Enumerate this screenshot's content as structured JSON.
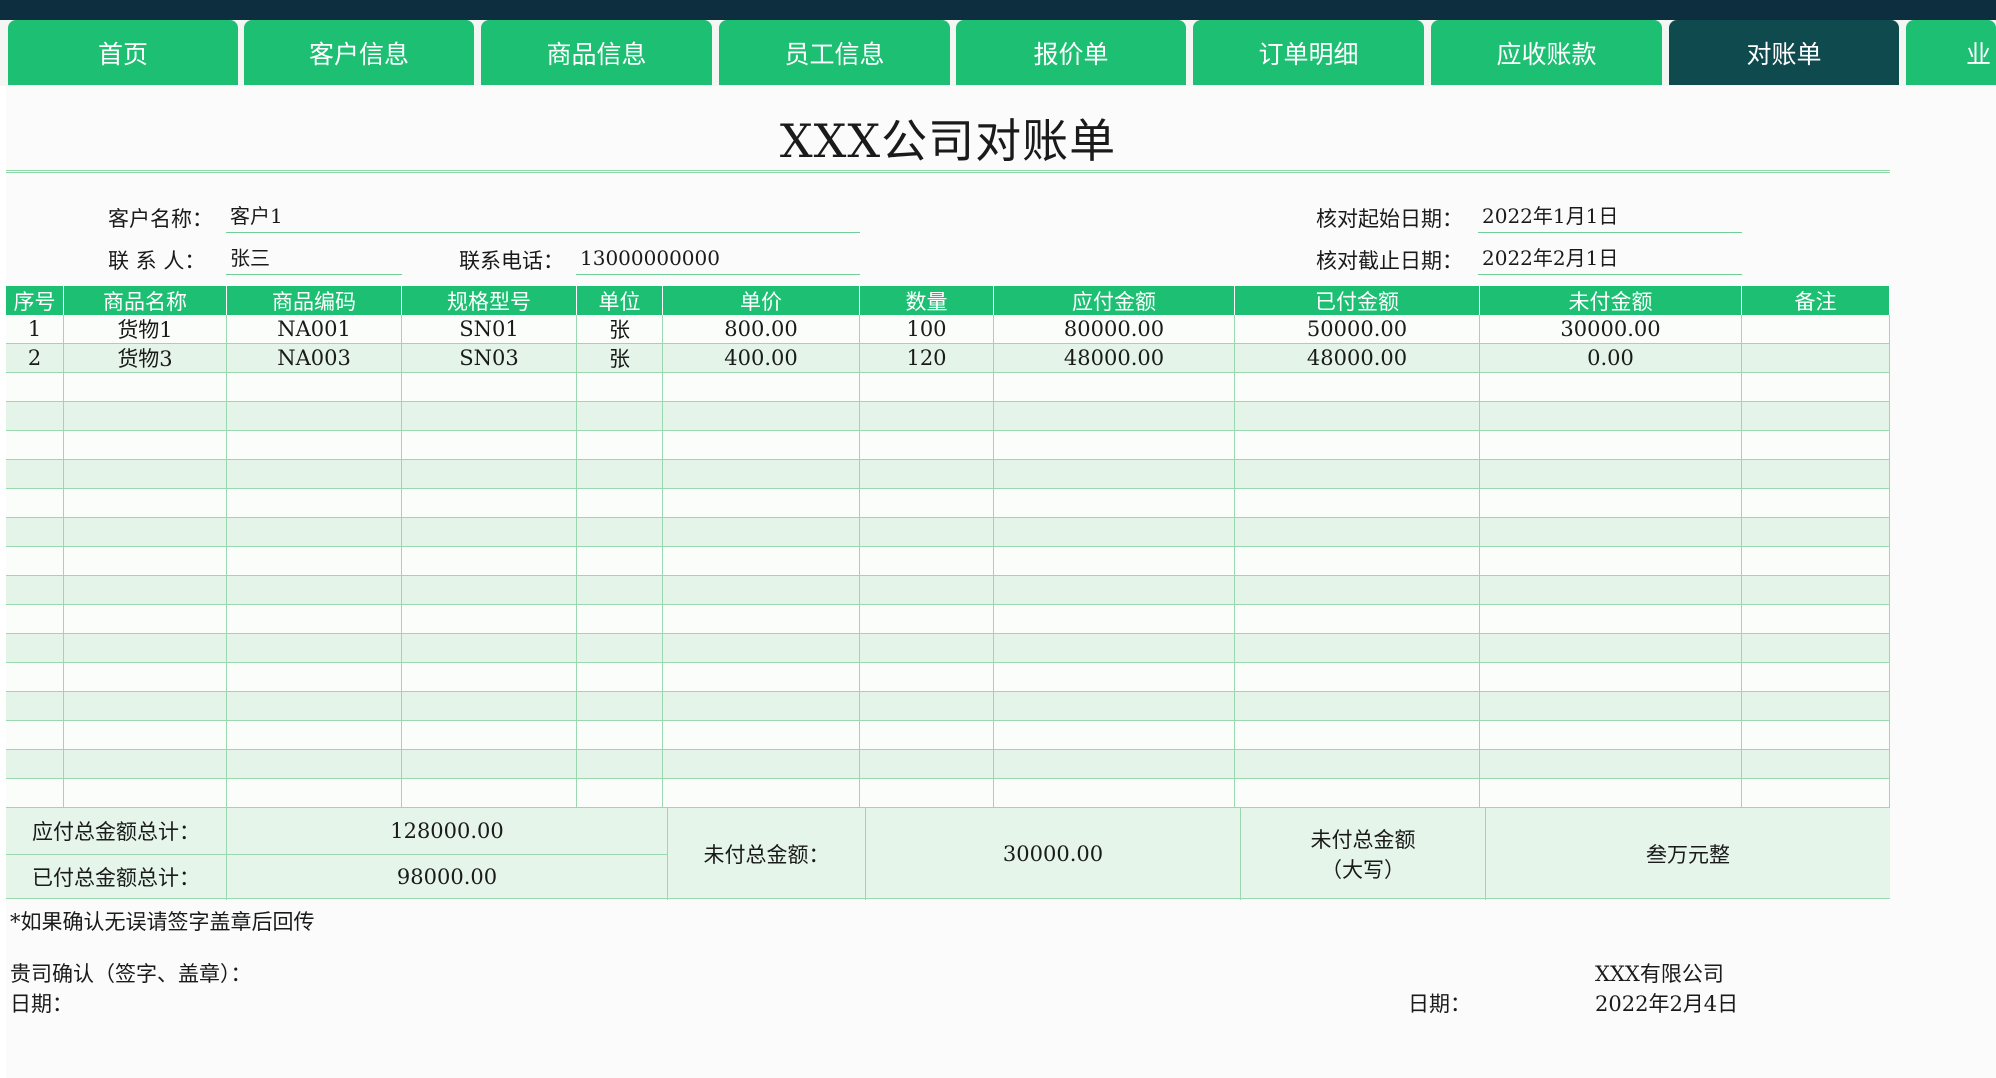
{
  "nav": {
    "tabs": [
      {
        "label": "首页"
      },
      {
        "label": "客户信息"
      },
      {
        "label": "商品信息"
      },
      {
        "label": "员工信息"
      },
      {
        "label": "报价单"
      },
      {
        "label": "订单明细"
      },
      {
        "label": "应收账款"
      },
      {
        "label": "对账单"
      },
      {
        "label": "业"
      }
    ],
    "active_index": 7
  },
  "doc": {
    "title": "XXX公司对账单",
    "customer_label": "客户名称：",
    "customer_value": "客户1",
    "contact_label": "联 系 人：",
    "contact_value": "张三",
    "phone_label": "联系电话：",
    "phone_value": "13000000000",
    "start_label": "核对起始日期：",
    "start_value": "2022年1月1日",
    "end_label": "核对截止日期：",
    "end_value": "2022年2月1日"
  },
  "table": {
    "columns": [
      "序号",
      "商品名称",
      "商品编码",
      "规格型号",
      "单位",
      "单价",
      "数量",
      "应付金额",
      "已付金额",
      "未付金额",
      "备注"
    ],
    "rows": [
      [
        "1",
        "货物1",
        "NA001",
        "SN01",
        "张",
        "800.00",
        "100",
        "80000.00",
        "50000.00",
        "30000.00",
        ""
      ],
      [
        "2",
        "货物3",
        "NA003",
        "SN03",
        "张",
        "400.00",
        "120",
        "48000.00",
        "48000.00",
        "0.00",
        ""
      ]
    ],
    "empty_rows": 15
  },
  "summary": {
    "payable_label": "应付总金额总计：",
    "payable_value": "128000.00",
    "paid_label": "已付总金额总计：",
    "paid_value": "98000.00",
    "unpaid_label": "未付总金额：",
    "unpaid_value": "30000.00",
    "unpaid_upper_label_1": "未付总金额",
    "unpaid_upper_label_2": "（大写）",
    "unpaid_upper_value": "叁万元整"
  },
  "footer": {
    "note": "*如果确认无误请签字盖章后回传",
    "confirm_label": "贵司确认（签字、盖章）：",
    "date_label_left": "日期：",
    "company": "XXX有限公司",
    "date_label_right": "日期：",
    "date_value": "2022年2月4日"
  },
  "colors": {
    "tab": "#1dbf73",
    "tab_active": "#0f4a4e",
    "header": "#1dbf73",
    "row_alt": "#e4f4e8"
  }
}
